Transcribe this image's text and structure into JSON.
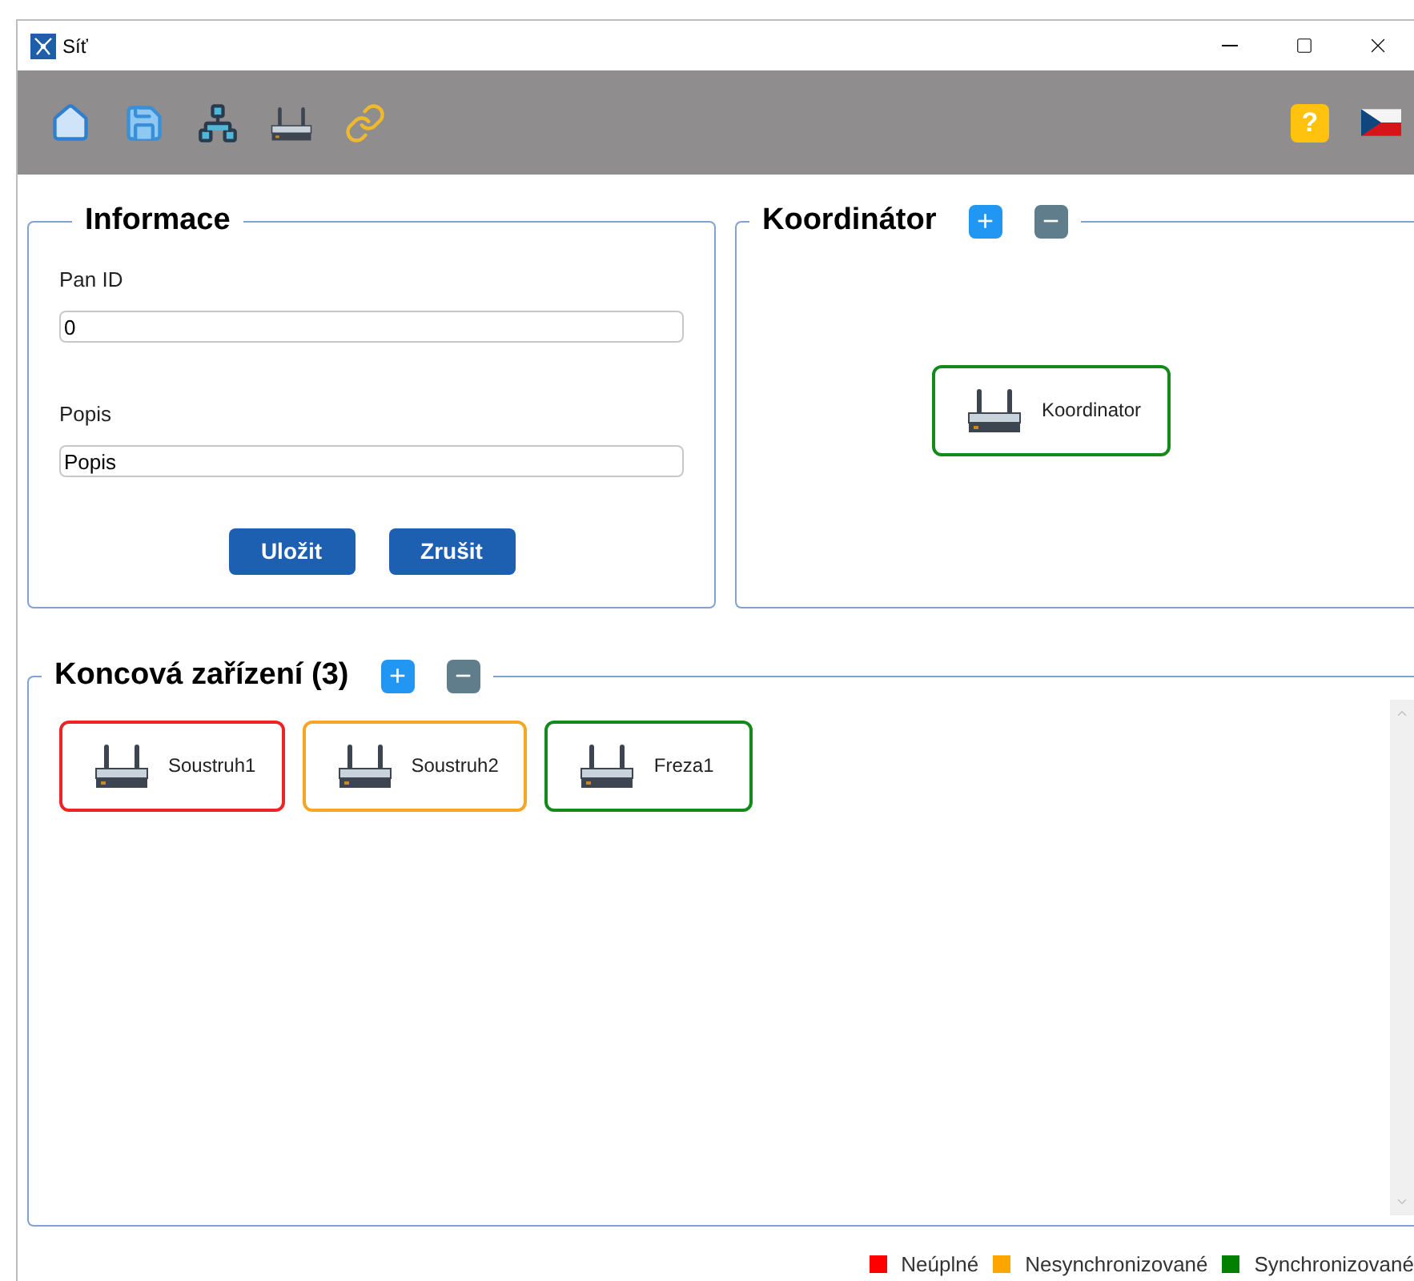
{
  "window": {
    "title": "Síť"
  },
  "toolbar": {
    "help_label": "?"
  },
  "info": {
    "title": "Informace",
    "fields": [
      {
        "label": "Pan ID",
        "value": "0"
      },
      {
        "label": "Popis",
        "value": "Popis"
      }
    ],
    "buttons": [
      "Uložit",
      "Zrušit"
    ]
  },
  "coordinator": {
    "title": "Koordinátor",
    "add": "+",
    "remove": "−",
    "devices": [
      {
        "name": "Koordinator",
        "color": "#15891a"
      }
    ]
  },
  "end_devices": {
    "title": "Koncová zařízení (3)",
    "add": "+",
    "remove": "−",
    "devices": [
      {
        "name": "Soustruh1",
        "color": "#ee2424"
      },
      {
        "name": "Soustruh2",
        "color": "#f5a623"
      },
      {
        "name": "Freza1",
        "color": "#15891a"
      }
    ]
  },
  "legend": [
    {
      "label": "Neúplné",
      "color": "#ff0000"
    },
    {
      "label": "Nesynchronizované",
      "color": "#ffa500"
    },
    {
      "label": "Synchronizované",
      "color": "#008000"
    }
  ]
}
